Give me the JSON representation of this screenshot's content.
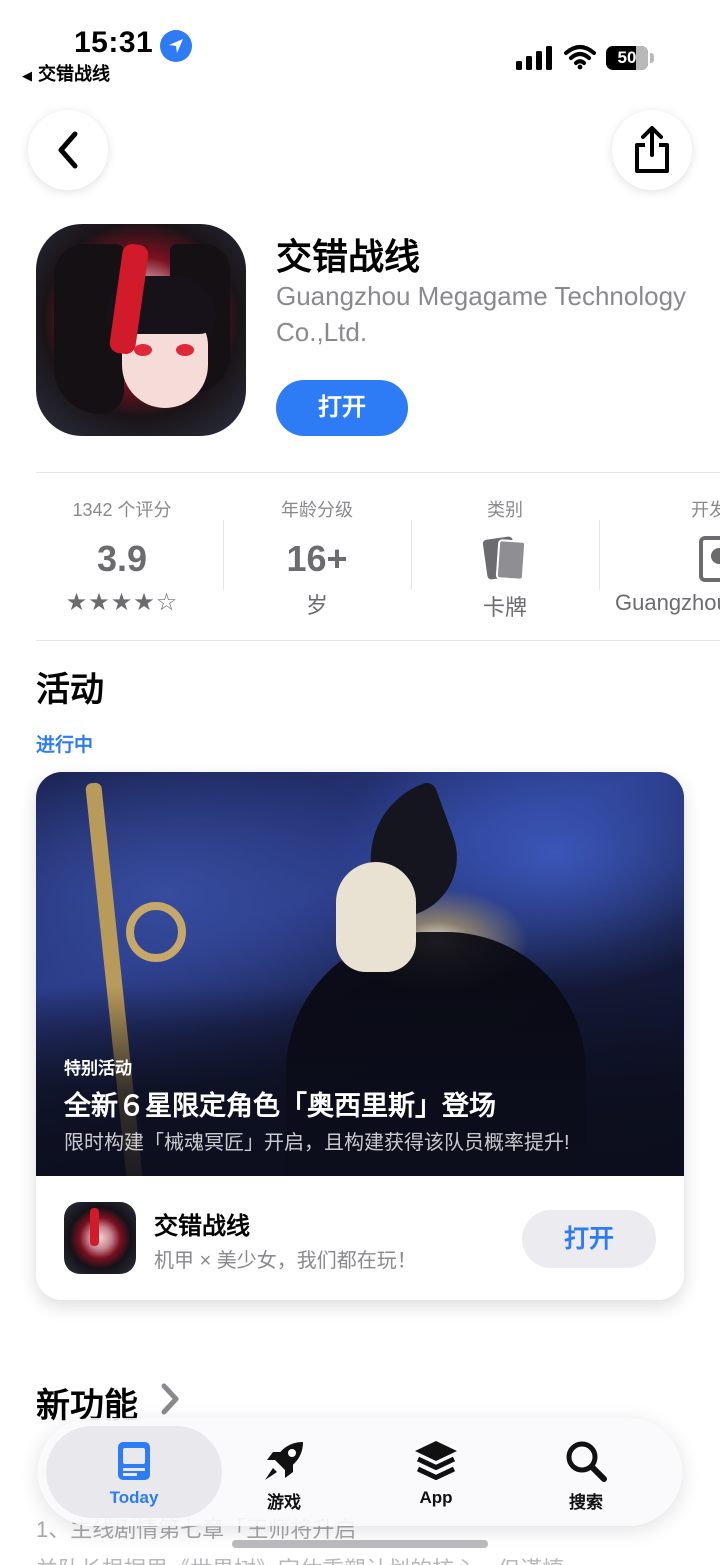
{
  "status_bar": {
    "time": "15:31",
    "back_app": "交错战线",
    "battery": "50"
  },
  "app": {
    "title": "交错战线",
    "developer": "Guangzhou Megagame Technology Co.,Ltd.",
    "open_label": "打开"
  },
  "info": {
    "ratings": {
      "label": "1342 个评分",
      "value": "3.9",
      "stars": "★★★★☆",
      "stars_value": 3.9
    },
    "age": {
      "label": "年龄分级",
      "value": "16+",
      "sub": "岁"
    },
    "category": {
      "label": "类别",
      "icon": "cards-icon",
      "sub": "卡牌"
    },
    "developer": {
      "label": "开发",
      "icon": "developer-icon",
      "sub": "Guangzhou"
    }
  },
  "events": {
    "section_title": "活动",
    "status": "进行中",
    "card": {
      "kind": "特别活动",
      "title": "全新６星限定角色「奥西里斯」登场",
      "description": "限时构建「械魂冥匠」开启，且构建获得该队员概率提升!",
      "app_name": "交错战线",
      "app_subtitle": "机甲 × 美少女，我们都在玩！",
      "open_label": "打开"
    }
  },
  "whats_new": {
    "title": "新功能",
    "line1": "1、主线剧情第七章「王师将升启",
    "line2": "并队长根据里《世界树》定休重塑计划的核心，但谨慎"
  },
  "tab_bar": {
    "tabs": [
      {
        "label": "Today",
        "icon": "today-icon",
        "active": true
      },
      {
        "label": "游戏",
        "icon": "rocket-icon",
        "active": false
      },
      {
        "label": "App",
        "icon": "layers-icon",
        "active": false
      },
      {
        "label": "搜索",
        "icon": "search-icon",
        "active": false
      }
    ]
  },
  "colors": {
    "accent": "#2d7cf6",
    "secondary_text": "#8a8a8e"
  }
}
